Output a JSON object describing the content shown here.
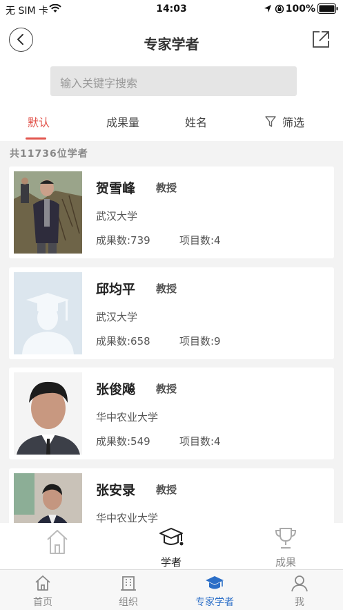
{
  "status_bar": {
    "carrier": "无 SIM 卡",
    "time": "14:03",
    "battery": "100%"
  },
  "header": {
    "title": "专家学者"
  },
  "search": {
    "placeholder": "输入关键字搜索"
  },
  "sort_tabs": [
    {
      "label": "默认",
      "active": true
    },
    {
      "label": "成果量"
    },
    {
      "label": "姓名"
    },
    {
      "label": "筛选",
      "icon": "filter-icon"
    }
  ],
  "summary": {
    "count_text": "共11736位学者"
  },
  "scholars": [
    {
      "name": "贺雪峰",
      "rank": "教授",
      "school": "武汉大学",
      "results": "成果数:739",
      "projects": "项目数:4"
    },
    {
      "name": "邱均平",
      "rank": "教授",
      "school": "武汉大学",
      "results": "成果数:658",
      "projects": "项目数:9"
    },
    {
      "name": "张俊飚",
      "rank": "教授",
      "school": "华中农业大学",
      "results": "成果数:549",
      "projects": "项目数:4"
    },
    {
      "name": "张安录",
      "rank": "教授",
      "school": "华中农业大学",
      "results": "",
      "projects": ""
    }
  ],
  "sub_nav": [
    {
      "label": "",
      "icon": "home-outline-icon"
    },
    {
      "label": "学者",
      "icon": "graduation-cap-icon",
      "active": true
    },
    {
      "label": "成果",
      "icon": "trophy-icon"
    }
  ],
  "tab_bar": [
    {
      "label": "首页",
      "icon": "home-icon"
    },
    {
      "label": "组织",
      "icon": "building-icon"
    },
    {
      "label": "专家学者",
      "icon": "graduation-cap-icon",
      "active": true
    },
    {
      "label": "我",
      "icon": "person-icon"
    }
  ],
  "colors": {
    "accent": "#e2554d",
    "active_tab": "#2b6ec7",
    "background": "#f3f3f3"
  }
}
